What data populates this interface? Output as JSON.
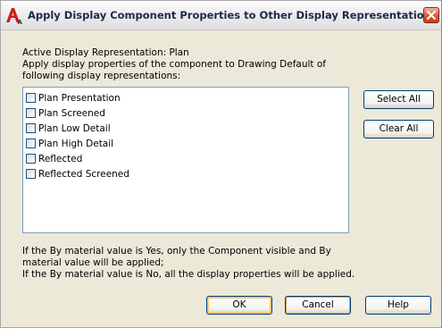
{
  "window": {
    "title": "Apply Display Component Properties to Other Display Representations",
    "icon": "autocad-app-icon",
    "close_icon": "close-icon"
  },
  "info": {
    "active_display_rep": "Active Display Representation:  Plan",
    "instruction_line1": "Apply display properties of the component to Drawing Default of",
    "instruction_line2": "following display representations:"
  },
  "representations": [
    {
      "label": "Plan Presentation",
      "checked": false
    },
    {
      "label": "Plan Screened",
      "checked": false
    },
    {
      "label": "Plan Low Detail",
      "checked": false
    },
    {
      "label": "Plan High Detail",
      "checked": false
    },
    {
      "label": "Reflected",
      "checked": false
    },
    {
      "label": "Reflected Screened",
      "checked": false
    }
  ],
  "side_buttons": {
    "select_all": "Select All",
    "clear_all": "Clear All"
  },
  "notes": {
    "line1": "If the By material value is Yes, only the Component visible and By",
    "line2": "material value will be applied;",
    "line3": "If the By material value is No, all the display properties will be applied."
  },
  "footer": {
    "ok": "OK",
    "cancel": "Cancel",
    "help": "Help"
  },
  "colors": {
    "title_text": "#1c2a47",
    "close_button": "#d65a3a",
    "button_border": "#003c74",
    "list_border": "#7f9db9"
  }
}
